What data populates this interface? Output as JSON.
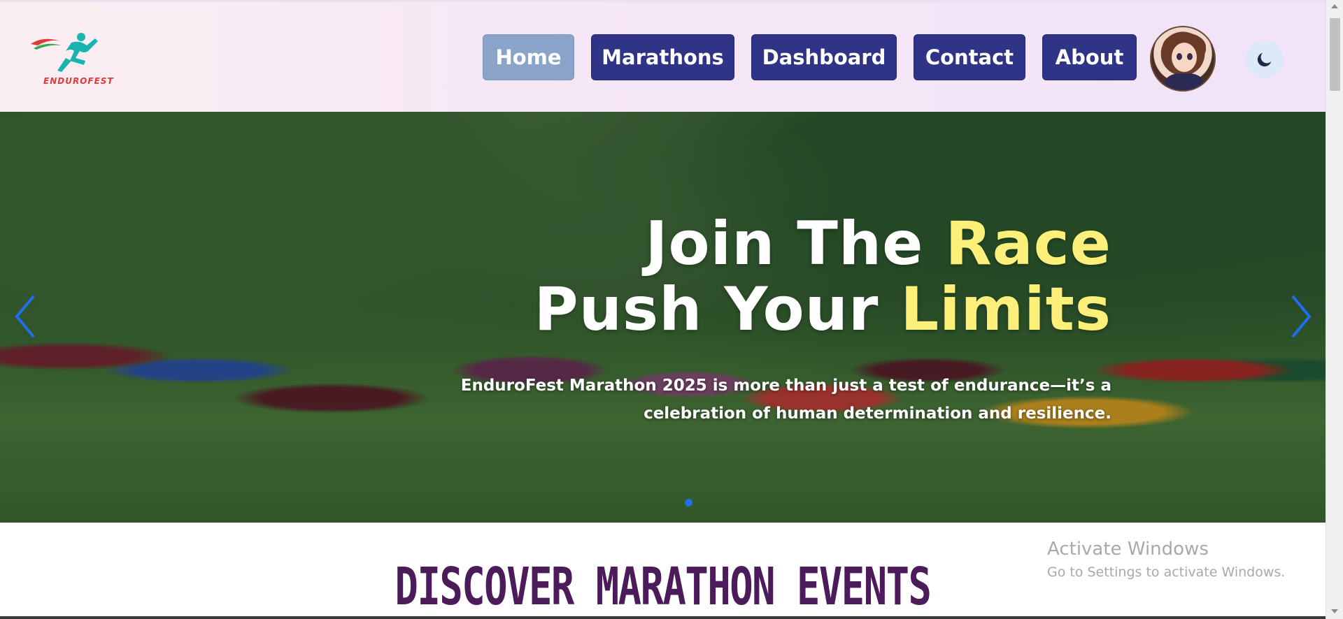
{
  "brand": {
    "logo_text_part1": "ENDURO",
    "logo_text_part2": "FEST",
    "logo_icon": "runner-logo-icon",
    "colors": {
      "red": "#e03a3a",
      "teal": "#19b3b0",
      "green": "#3aa64a"
    }
  },
  "nav": {
    "items": [
      {
        "label": "Home",
        "active": true
      },
      {
        "label": "Marathons",
        "active": false
      },
      {
        "label": "Dashboard",
        "active": false
      },
      {
        "label": "Contact",
        "active": false
      },
      {
        "label": "About",
        "active": false
      }
    ],
    "avatar_icon": "user-avatar",
    "theme_toggle_icon": "moon-icon",
    "colors": {
      "button": "#2f3486",
      "active_button": "#8aa4c9"
    }
  },
  "hero": {
    "line1_white": "Join The ",
    "line1_yellow": "Race",
    "line2_white": "Push Your ",
    "line2_yellow": "Limits",
    "subtitle": "EnduroFest Marathon 2025 is more than just a test of endurance—it’s a celebration of human determination and resilience.",
    "prev_icon": "chevron-left-icon",
    "next_icon": "chevron-right-icon",
    "accent": "#fdf07a"
  },
  "section": {
    "title": "DISCOVER MARATHON EVENTS"
  },
  "watermark": {
    "line1": "Activate Windows",
    "line2": "Go to Settings to activate Windows."
  }
}
